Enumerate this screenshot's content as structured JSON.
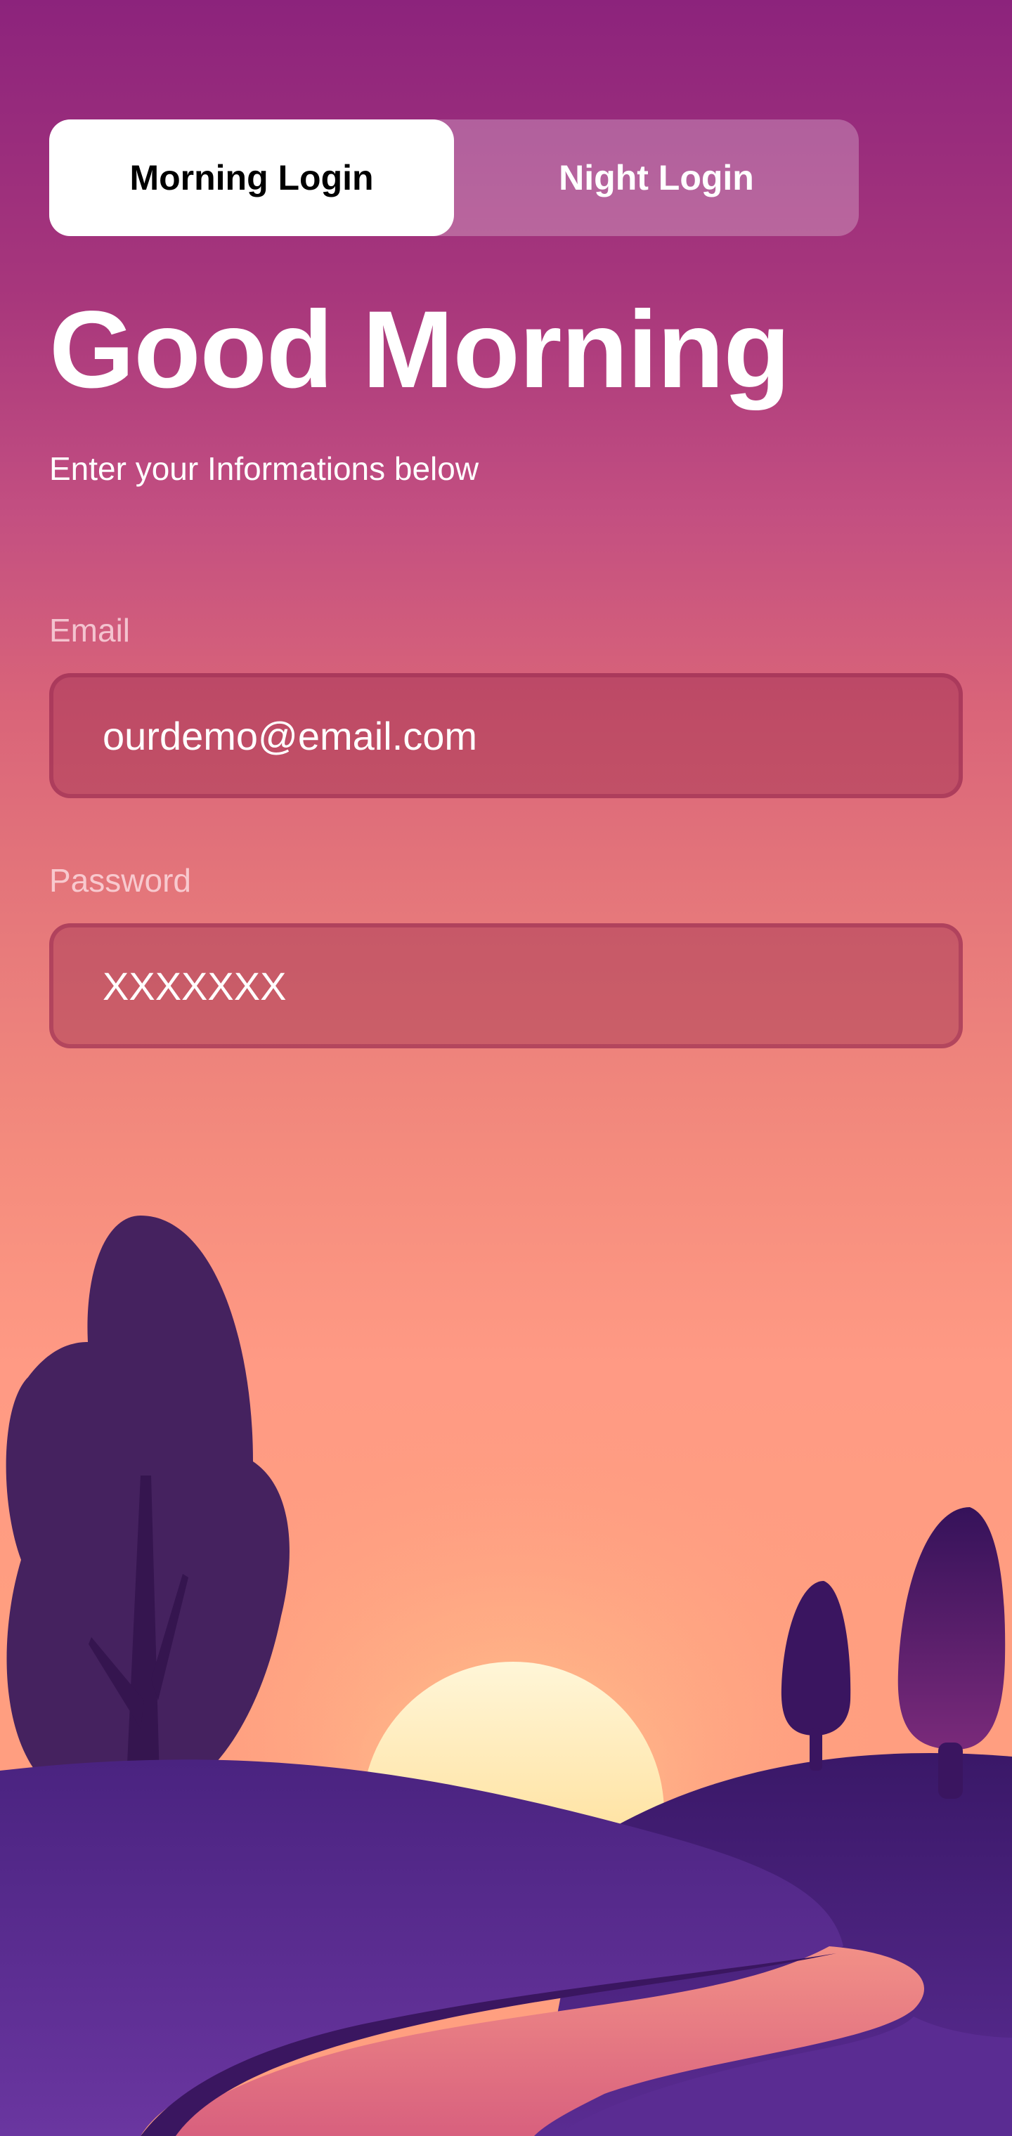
{
  "toggle": {
    "morning_label": "Morning Login",
    "night_label": "Night Login",
    "selected": "Morning Login"
  },
  "header": {
    "title": "Good Morning",
    "subtitle": "Enter your Informations below"
  },
  "form": {
    "email": {
      "label": "Email",
      "value": "ourdemo@email.com"
    },
    "password": {
      "label": "Password",
      "value": "XXXXXXX"
    }
  },
  "colors": {
    "sky_top": "#8c237c",
    "sky_bottom": "#ff9f80",
    "sun": "#ffe08a",
    "hills": "#4a2580",
    "trees": "#45215f",
    "path": "#e8787a"
  }
}
